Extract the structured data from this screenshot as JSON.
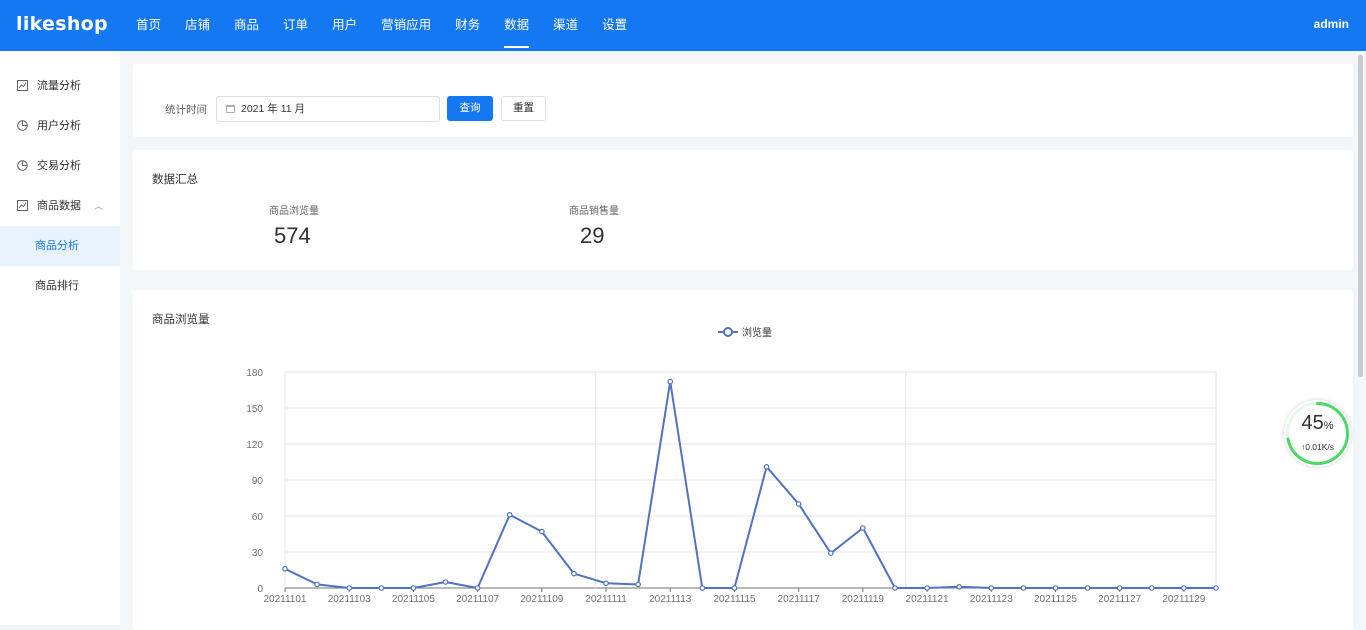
{
  "brand": {
    "logo": "likeshop"
  },
  "nav": {
    "items": [
      "首页",
      "店铺",
      "商品",
      "订单",
      "用户",
      "营销应用",
      "财务",
      "数据",
      "渠道",
      "设置"
    ],
    "active": "数据",
    "user": "admin"
  },
  "sidebar": {
    "items": [
      {
        "label": "流量分析",
        "icon": "line-chart-icon"
      },
      {
        "label": "用户分析",
        "icon": "pie-chart-icon"
      },
      {
        "label": "交易分析",
        "icon": "pie-chart-icon"
      },
      {
        "label": "商品数据",
        "icon": "line-chart-icon",
        "expanded": true
      }
    ],
    "sub_items": [
      {
        "label": "商品分析",
        "active": true
      },
      {
        "label": "商品排行",
        "active": false
      }
    ]
  },
  "filter": {
    "label": "统计时间",
    "date_value": "2021 年 11 月",
    "query_button": "查询",
    "reset_button": "重置"
  },
  "summary": {
    "title": "数据汇总",
    "stats": [
      {
        "label": "商品浏览量",
        "value": "574"
      },
      {
        "label": "商品销售量",
        "value": "29"
      }
    ]
  },
  "chart_section": {
    "title": "商品浏览量"
  },
  "chart_data": {
    "type": "line",
    "title": "商品浏览量",
    "x": [
      "20211101",
      "20211102",
      "20211103",
      "20211104",
      "20211105",
      "20211106",
      "20211107",
      "20211108",
      "20211109",
      "20211110",
      "20211111",
      "20211112",
      "20211113",
      "20211114",
      "20211115",
      "20211116",
      "20211117",
      "20211118",
      "20211119",
      "20211120",
      "20211121",
      "20211122",
      "20211123",
      "20211124",
      "20211125",
      "20211126",
      "20211127",
      "20211128",
      "20211129",
      "20211130"
    ],
    "x_tick_labels": [
      "20211101",
      "20211103",
      "20211105",
      "20211107",
      "20211109",
      "20211111",
      "20211113",
      "20211115",
      "20211117",
      "20211119",
      "20211121",
      "20211123",
      "20211125",
      "20211127",
      "20211129"
    ],
    "series": [
      {
        "name": "浏览量",
        "color": "#4f72c4",
        "values": [
          16,
          3,
          0,
          0,
          0,
          5,
          0,
          61,
          47,
          12,
          4,
          3,
          172,
          0,
          0,
          101,
          70,
          29,
          50,
          0,
          0,
          1,
          0,
          0,
          0,
          0,
          0,
          0,
          0,
          0
        ]
      }
    ],
    "ylim": [
      0,
      180
    ],
    "yticks": [
      0,
      30,
      60,
      90,
      120,
      150,
      180
    ],
    "grid": true,
    "legend": "top-center"
  },
  "widget": {
    "percent": "45",
    "percent_sign": "%",
    "rate": "0.01K/s",
    "ring_color": "#4cd964",
    "progress": 0.45
  }
}
